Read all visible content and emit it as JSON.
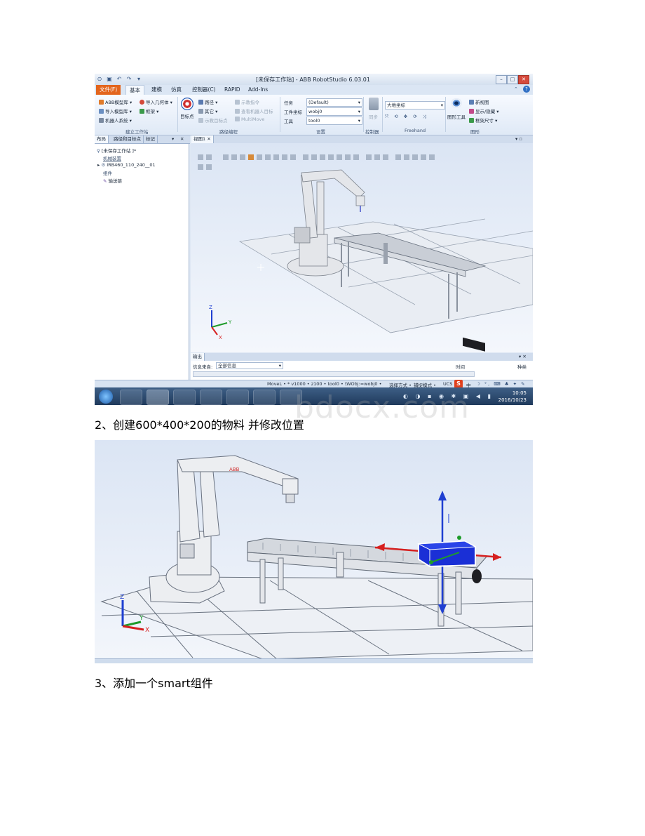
{
  "window": {
    "title": "[未保存工作站] - ABB RobotStudio 6.03.01"
  },
  "ribbon_tabs": [
    "文件(F)",
    "基本",
    "建模",
    "仿真",
    "控制器(C)",
    "RAPID",
    "Add-Ins"
  ],
  "ribbon": {
    "build_station": {
      "items": [
        "ABB模型库",
        "导入几何体",
        "导入模型库",
        "框架",
        "机器人系统"
      ],
      "label": "建立工作站"
    },
    "path_programming": {
      "target_button": "目标点",
      "items": [
        "路径",
        "其它",
        "示教目标点",
        "示教指令",
        "查看机器人目标",
        "MultiMove"
      ],
      "label": "路径编程"
    },
    "settings": {
      "task_label": "任务",
      "task_value": "(Default)",
      "wobj_label": "工件坐标",
      "wobj_value": "wobj0",
      "tool_label": "工具",
      "tool_value": "tool0",
      "label": "设置"
    },
    "controller": {
      "sync_button": "同步",
      "label": "控制器"
    },
    "freehand": {
      "coord_value": "大地坐标",
      "label": "Freehand"
    },
    "graphics": {
      "graphics_tools": "图形工具",
      "items": [
        "新视图",
        "显示/隐藏",
        "框架尺寸"
      ],
      "label": "图形"
    }
  },
  "left_panel": {
    "tabs": [
      "布局",
      "路径和目标点",
      "标记"
    ],
    "tree": {
      "station": "[未保存工作站 ]*",
      "mechanisms_header": "机械装置",
      "robot": "IRB460_110_240__01",
      "components_header": "组件",
      "conveyor": "输送链"
    }
  },
  "viewport": {
    "tab": "视图1"
  },
  "output": {
    "tab": "输出",
    "filter_label": "信息来自:",
    "filter_value": "全部信息",
    "time_header": "时间",
    "category_header": "种类"
  },
  "statusbar": {
    "instruction": "MoveL • * v1000 • z100 • tool0 • \\WObj:=wobj0 •",
    "select_mode": "选择方式 •",
    "snap_mode": "捕捉模式 •",
    "ucs": "UCS",
    "ime": "中"
  },
  "taskbar": {
    "time": "10:05",
    "date": "2016/10/23"
  },
  "captions": {
    "step2": "2、创建600*400*200的物料 并修改位置",
    "step3": "3、添加一个smart组件"
  },
  "colors": {
    "file_tab": "#e3651d",
    "ribbon_bg": "#dfe9f6",
    "axis_x": "#d62020",
    "axis_y": "#1e9b2a",
    "axis_z": "#1f3fd1",
    "box_fill": "#1a2fd6"
  }
}
